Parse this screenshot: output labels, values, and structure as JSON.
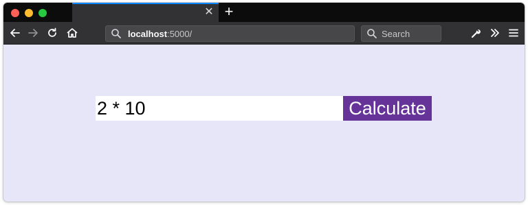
{
  "browser": {
    "tab": {
      "title": ""
    },
    "address_bar": {
      "host": "localhost",
      "rest": ":5000/"
    },
    "search_bar": {
      "placeholder": "Search"
    }
  },
  "page": {
    "expression_input": {
      "value": "2 * 10"
    },
    "calculate_button": {
      "label": "Calculate"
    }
  },
  "colors": {
    "page_background": "#e6e6f8",
    "button_background": "#663399",
    "tab_accent": "#0a84ff"
  }
}
